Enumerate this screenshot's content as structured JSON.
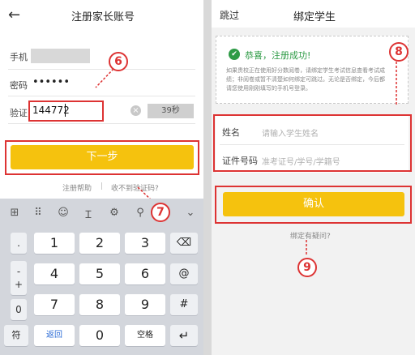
{
  "left": {
    "header": {
      "back_icon": "←",
      "title": "注册家长账号"
    },
    "phone_label": "手机",
    "password_label": "密码",
    "password_value": "••••••",
    "verify_label": "验证",
    "verify_value": "144772",
    "clear_icon": "×",
    "countdown": "39秒",
    "next_button": "下一步",
    "help_link": "注册帮助",
    "separator": "|",
    "no_code_link": "收不到验证码?",
    "annotations": {
      "six": "6",
      "seven": "7"
    }
  },
  "keyboard": {
    "toolbar": [
      "⊞",
      "⠿",
      "☺",
      "Ɪ",
      "⚙",
      "⚲",
      "⌄"
    ],
    "left_keys": [
      ".",
      "-",
      "+",
      "0"
    ],
    "digits": [
      "1",
      "2",
      "3",
      "4",
      "5",
      "6",
      "7",
      "8",
      "9"
    ],
    "backspace": "⌫",
    "at": "@",
    "enter_symbol": "#",
    "bottom": {
      "symbols": "符",
      "return": "返回",
      "zero": "0",
      "space": "空格",
      "enter": "↵"
    }
  },
  "right": {
    "header": {
      "skip": "跳过",
      "title": "绑定学生"
    },
    "success_icon": "✔",
    "success_text": "恭喜，注册成功!",
    "info_text": "如果贵校正在使用好分数阅卷，请绑定学生考试信息查看考试成绩；非阅卷或暂不清楚如何绑定可跳过。无论是否绑定，今后都请您使用刚刚填写的手机号登录。",
    "name_label": "姓名",
    "name_placeholder": "请输入学生姓名",
    "id_label": "证件号码",
    "id_placeholder": "准考证号/学号/学籍号",
    "confirm_button": "确认",
    "binding_help": "绑定有疑问?",
    "annotations": {
      "eight": "8",
      "nine": "9"
    }
  },
  "colors": {
    "accent": "#f5c20e",
    "annotation_red": "#d33333",
    "success_green": "#2e9b46"
  }
}
